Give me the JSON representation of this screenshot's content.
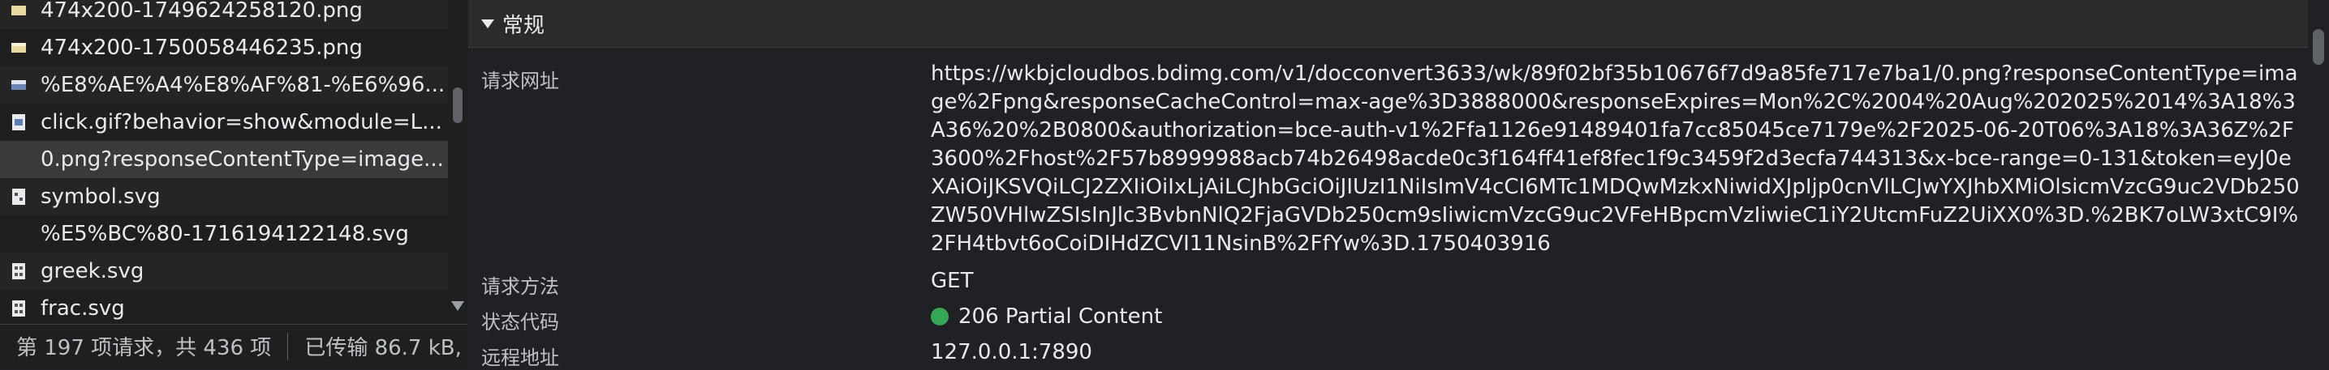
{
  "network_list": {
    "rows": [
      {
        "name": "474x200-1749624258120.png",
        "icon": "png-image-icon"
      },
      {
        "name": "474x200-1750058446235.png",
        "icon": "png-image-icon"
      },
      {
        "name": "%E8%AE%A4%E8%AF%81-%E6%96...",
        "icon": "image-file-icon"
      },
      {
        "name": "click.gif?behavior=show&module=L...",
        "icon": "gif-image-icon"
      },
      {
        "name": "0.png?responseContentType=image...",
        "icon": "none"
      },
      {
        "name": "symbol.svg",
        "icon": "svg-file-icon"
      },
      {
        "name": "%E5%BC%80-1716194122148.svg",
        "icon": "none"
      },
      {
        "name": "greek.svg",
        "icon": "svg-file-icon"
      },
      {
        "name": "frac.svg",
        "icon": "svg-file-icon"
      }
    ],
    "selected_index": 4
  },
  "status_bar": {
    "requests": "第 197 项请求，共 436 项",
    "transferred": "已传输 86.7 kB,"
  },
  "headers": {
    "section_title": "常规",
    "request_url_label": "请求网址",
    "request_url": "https://wkbjcloudbos.bdimg.com/v1/docconvert3633/wk/89f02bf35b10676f7d9a85fe717e7ba1/0.png?responseContentType=image%2Fpng&responseCacheControl=max-age%3D3888000&responseExpires=Mon%2C%2004%20Aug%202025%2014%3A18%3A36%20%2B0800&authorization=bce-auth-v1%2Ffa1126e91489401fa7cc85045ce7179e%2F2025-06-20T06%3A18%3A36Z%2F3600%2Fhost%2F57b8999988acb74b26498acde0c3f164ff41ef8fec1f9c3459f2d3ecfa744313&x-bce-range=0-131&token=eyJ0eXAiOiJKSVQiLCJ2ZXIiOiIxLjAiLCJhbGciOiJIUzI1NiIsImV4cCI6MTc1MDQwMzkxNiwidXJpIjp0cnVlLCJwYXJhbXMiOlsicmVzcG9uc2VDb250ZW50VHlwZSIsInJlc3BvbnNlQ2FjaGVDb250cm9sIiwicmVzcG9uc2VFeHBpcmVzIiwieC1iY2UtcmFuZ2UiXX0%3D.%2BK7oLW3xtC9I%2FH4tbvt6oCoiDIHdZCVI11NsinB%2FfYw%3D.1750403916",
    "method_label": "请求方法",
    "method": "GET",
    "status_label": "状态代码",
    "status": "206 Partial Content",
    "status_color": "#34a853",
    "remote_label": "远程地址",
    "remote": "127.0.0.1:7890"
  }
}
